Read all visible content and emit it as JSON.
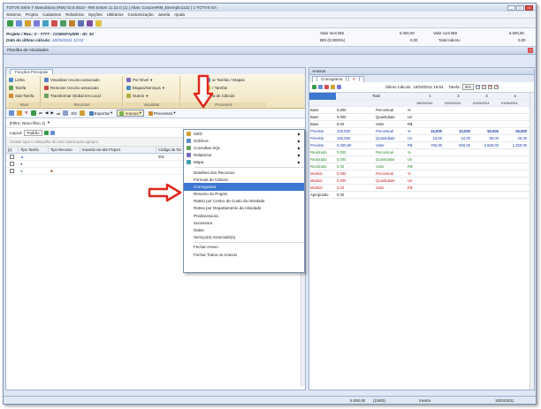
{
  "window": {
    "title": "TOTVS Série T Manufatura (RM) 03.0.0513 - RM Solum 11.22.0 (1) | Alias: CorporeRM_Exemplo1122 | 1-TOTVS SA",
    "minimize_label": "_",
    "maximize_label": "□",
    "close_label": "×"
  },
  "menubar": {
    "items": [
      "Sistema",
      "Projeto",
      "Cadastros",
      "Relatórios",
      "Opções",
      "Utilitários",
      "Customização",
      "Janela",
      "Ajuda"
    ]
  },
  "infobar": {
    "project_line": "Projeto / Rev.: 0 - 7777 - COMOFAZER - ID: 30",
    "calc_label": "Data do último cálculo:",
    "calc_value": "18/03/2011 13:53",
    "valor_sem_bdi_label": "Valor sem BDI",
    "valor_sem_bdi_value": "5.000,00",
    "bdi_label": "BDI (0,0000%)",
    "bdi_value": "0,00",
    "valor_com_bdi_label": "Valor com BDI",
    "valor_com_bdi_value": "5.000,00",
    "total_indireto_label": "Total Indireto",
    "total_indireto_value": "0,00"
  },
  "planilha": {
    "title": "Planilha de Atividades",
    "ribbon_tab": "Funções Principais",
    "groups": [
      {
        "label": "Novo",
        "items": [
          "Linha",
          "Tarefa",
          "Sub-Tarefa"
        ]
      },
      {
        "label": "Recursos",
        "items": [
          "Visualizar recurso associado",
          "Remover recurso associado",
          "Transformar Global em Local"
        ]
      },
      {
        "label": "Visualizar",
        "items": [
          "Por Nível",
          "Etapas/Serviços",
          "Outros"
        ]
      },
      {
        "label": "Processos",
        "items": [
          "ar Tarefas / Etapas",
          "r Tarefas",
          "la de Cálculo"
        ]
      }
    ],
    "toolbar": {
      "page": "3/3",
      "exportar": "Exportar",
      "anexos": "Anexos",
      "processos": "Processos"
    },
    "filter": "[Filtro: Novo filtro 1]",
    "layout_label": "Layout:",
    "layout_value": "Padrão",
    "group_hint": "Arraste aqui o cabeçalho de uma coluna para agrupar",
    "columns": [
      "[x]",
      "Tipo Tarefa",
      "Tipo Recurso",
      "Inserido via MS Project",
      "Código da Tar"
    ],
    "rows": [
      {
        "codigo": "001"
      },
      {
        "codigo": ""
      },
      {
        "codigo": ""
      }
    ]
  },
  "anexos_menu": {
    "items": [
      {
        "label": "GED",
        "submenu": true
      },
      {
        "label": "Gráficos",
        "submenu": true
      },
      {
        "label": "Consultas SQL",
        "submenu": true
      },
      {
        "label": "Relatórios",
        "submenu": true
      },
      {
        "label": "Mapa",
        "submenu": true
      },
      {
        "label": "Detalhes dos Recursos",
        "submenu": false
      },
      {
        "label": "Fórmula de Cálculo",
        "submenu": false
      },
      {
        "label": "Cronograma",
        "submenu": false,
        "highlighted": true
      },
      {
        "label": "Resumo do Projeto",
        "submenu": false
      },
      {
        "label": "Rateio por Centro de Custo da Atividade",
        "submenu": false
      },
      {
        "label": "Rateio por Departamento da Atividade",
        "submenu": false
      },
      {
        "label": "Predecessora",
        "submenu": false
      },
      {
        "label": "Sucessora",
        "submenu": false
      },
      {
        "label": "Datas",
        "submenu": false
      },
      {
        "label": "Serviço(s) Associado(s)",
        "submenu": false
      },
      {
        "label": "Fechar Anexo",
        "submenu": false
      },
      {
        "label": "Fechar Todos os Anexos",
        "submenu": false
      }
    ]
  },
  "anexos_pane": {
    "title": "Anexos",
    "tab": "Cronograma",
    "ultimo_calculo_label": "Último Cálculo:",
    "ultimo_calculo_value": "18/03/2011 16:53",
    "tarefa_label": "Tarefa:",
    "tarefa_value": "001",
    "letter_buttons": [
      "D",
      "S",
      "M",
      "A"
    ],
    "total_header": "Total",
    "period_numbers": [
      "1",
      "2",
      "3",
      "4"
    ],
    "period_dates": [
      "18/03/2011",
      "01/04/2011",
      "01/05/2011",
      "01/06/2011"
    ],
    "rows": [
      {
        "label": "Base",
        "value": "0,000",
        "kind": "Percentual",
        "unit": "%",
        "vals": [
          "",
          "",
          "",
          ""
        ],
        "style": "base"
      },
      {
        "label": "Base",
        "value": "0,000",
        "kind": "Quantidade",
        "unit": "Un",
        "vals": [
          "",
          "",
          "",
          ""
        ],
        "style": "base"
      },
      {
        "label": "Base",
        "value": "0,00",
        "kind": "Valor",
        "unit": "R$",
        "vals": [
          "",
          "",
          "",
          ""
        ],
        "style": "base"
      },
      {
        "label": "Previsto",
        "value": "100,000",
        "kind": "Percentual",
        "unit": "%",
        "vals": [
          "15,000",
          "10,000",
          "50,000",
          "25,000"
        ],
        "style": "previsto-bold"
      },
      {
        "label": "Previsto",
        "value": "100,000",
        "kind": "Quantidade",
        "unit": "Un",
        "vals": [
          "15,00",
          "10,00",
          "50,00",
          "25,00"
        ],
        "style": "previsto"
      },
      {
        "label": "Previsto",
        "value": "5.000,00",
        "kind": "Valor",
        "unit": "R$",
        "vals": [
          "750,00",
          "500,00",
          "2.500,00",
          "1.250,00"
        ],
        "style": "previsto"
      },
      {
        "label": "Realizado",
        "value": "0,000",
        "kind": "Percentual",
        "unit": "%",
        "vals": [
          "",
          "",
          "",
          ""
        ],
        "style": "realizado"
      },
      {
        "label": "Realizado",
        "value": "0,000",
        "kind": "Quantidade",
        "unit": "Un",
        "vals": [
          "",
          "",
          "",
          ""
        ],
        "style": "realizado"
      },
      {
        "label": "Realizado",
        "value": "0,00",
        "kind": "Valor",
        "unit": "R$",
        "vals": [
          "",
          "",
          "",
          ""
        ],
        "style": "realizado"
      },
      {
        "label": "Medido",
        "value": "0,000",
        "kind": "Percentual",
        "unit": "%",
        "vals": [
          "",
          "",
          "",
          ""
        ],
        "style": "medido"
      },
      {
        "label": "Medido",
        "value": "0,000",
        "kind": "Quantidade",
        "unit": "Un",
        "vals": [
          "",
          "",
          "",
          ""
        ],
        "style": "medido"
      },
      {
        "label": "Medido",
        "value": "0,00",
        "kind": "Valor",
        "unit": "R$",
        "vals": [
          "",
          "",
          "",
          ""
        ],
        "style": "medido"
      },
      {
        "label": "Apropriado",
        "value": "0,00",
        "kind": "",
        "unit": "",
        "vals": [
          "",
          "",
          "",
          ""
        ],
        "style": "base"
      }
    ]
  },
  "statusbar": {
    "value": "5.000,00",
    "count": "(1/803)",
    "user": "mestre",
    "date": "18/03/2011"
  },
  "colors": {
    "previsto": "#1a3fa6",
    "realizado": "#2e8b2e",
    "medido": "#cc2222",
    "highlight": "#3b76d1",
    "red_arrow": "#e0281e"
  }
}
